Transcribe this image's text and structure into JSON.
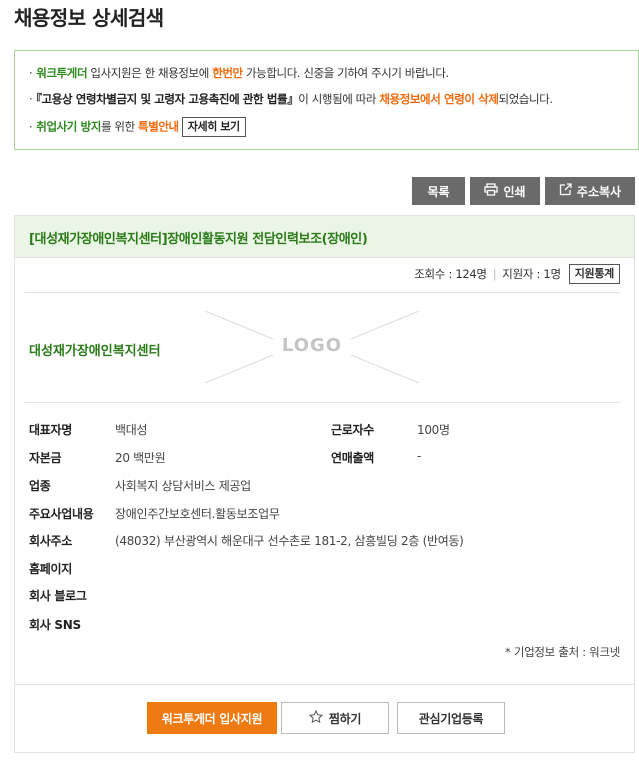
{
  "page": {
    "title": "채용정보 상세검색"
  },
  "notice": {
    "line1": {
      "brand": "워크투게더",
      "text_a": " 입사지원은 한 채용정보에 ",
      "highlight": "한번만",
      "text_b": " 가능합니다. 신중을 기하여 주시기 바랍니다."
    },
    "line2": {
      "law": "『고용상 연령차별금지 및 고령자 고용촉진에 관한 법률』",
      "text_a": "이 시행됨에 따라 ",
      "highlight": "채용정보에서 연령이 삭제",
      "text_b": "되었습니다."
    },
    "line3": {
      "emph": "취업사기 방지",
      "text_a": "를 위한 ",
      "highlight": "특별안내",
      "button": "자세히 보기"
    }
  },
  "toolbar": {
    "list": "목록",
    "print": "인쇄",
    "copy_address": "주소복사"
  },
  "job": {
    "title": "[대성재가장애인복지센터]장애인활동지원 전담인력보조(장애인)",
    "views_label": "조회수 : 124명",
    "applicants_label": "지원자 : 1명",
    "stats_button": "지원통계"
  },
  "company": {
    "name": "대성재가장애인복지센터",
    "logo_text": "LOGO",
    "fields": {
      "ceo_label": "대표자명",
      "ceo": "백대성",
      "employees_label": "근로자수",
      "employees": "100명",
      "capital_label": "자본금",
      "capital": "20 백만원",
      "revenue_label": "연매출액",
      "revenue": "-",
      "industry_label": "업종",
      "industry": "사회복지 상담서비스 제공업",
      "business_label": "주요사업내용",
      "business": "장애인주간보호센터.활동보조업무",
      "address_label": "회사주소",
      "address": "(48032) 부산광역시 해운대구 선수촌로 181-2, 삼흥빌딩 2층 (반여동)",
      "homepage_label": "홈페이지",
      "homepage": "",
      "blog_label": "회사 블로그",
      "blog": "",
      "sns_label": "회사 SNS",
      "sns": ""
    },
    "source": "* 기업정보 출처 : 워크넷"
  },
  "actions": {
    "apply": "워크투게더 입사지원",
    "scrap": "찜하기",
    "favorite": "관심기업등록"
  },
  "colors": {
    "accent_green": "#2a7a18",
    "accent_orange": "#f07a12",
    "toolbar_gray": "#6a6a6a"
  }
}
